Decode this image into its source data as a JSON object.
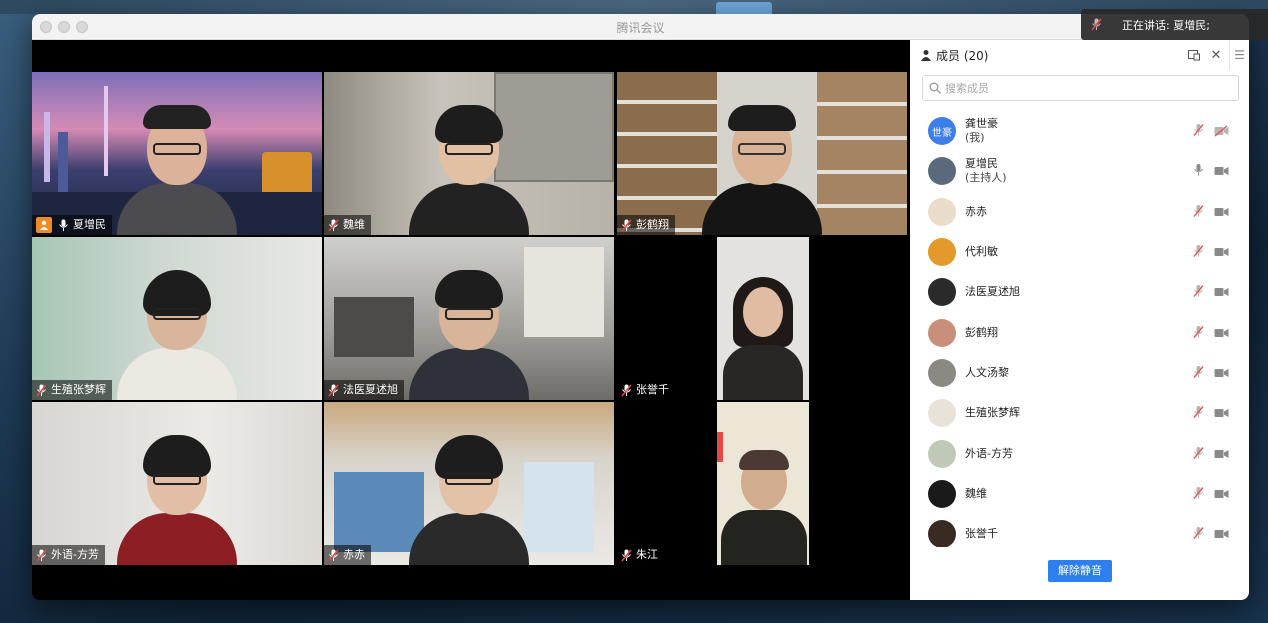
{
  "window": {
    "title": "腾讯会议"
  },
  "toast": {
    "speaking_label": "正在讲话: 夏增民;"
  },
  "tiles": [
    {
      "name": "夏增民",
      "host": true,
      "muted": false,
      "active": true
    },
    {
      "name": "魏维",
      "host": false,
      "muted": true,
      "active": false
    },
    {
      "name": "彭鹤翔",
      "host": false,
      "muted": true,
      "active": false
    },
    {
      "name": "生殖张梦辉",
      "host": false,
      "muted": true,
      "active": false
    },
    {
      "name": "法医夏述旭",
      "host": false,
      "muted": true,
      "active": false
    },
    {
      "name": "张誉千",
      "host": false,
      "muted": true,
      "active": false
    },
    {
      "name": "外语-方芳",
      "host": false,
      "muted": true,
      "active": false
    },
    {
      "name": "赤赤",
      "host": false,
      "muted": true,
      "active": false
    },
    {
      "name": "朱江",
      "host": false,
      "muted": true,
      "active": false
    }
  ],
  "panel": {
    "title": "成员 (20)",
    "search_placeholder": "搜索成员",
    "unmute_all_label": "解除静音",
    "members": [
      {
        "name": "龚世豪",
        "sub": "(我)",
        "avatar_text": "世豪",
        "avatar_color": "#3d7ee8",
        "mic_muted": true,
        "cam_off": true
      },
      {
        "name": "夏增民",
        "sub": "(主持人)",
        "avatar_text": "",
        "avatar_color": "#5a6a7c",
        "mic_muted": false,
        "cam_off": false
      },
      {
        "name": "赤赤",
        "sub": "",
        "avatar_text": "",
        "avatar_color": "#e9dcc8",
        "mic_muted": true,
        "cam_off": false
      },
      {
        "name": "代利敏",
        "sub": "",
        "avatar_text": "",
        "avatar_color": "#e39a2a",
        "mic_muted": true,
        "cam_off": false
      },
      {
        "name": "法医夏述旭",
        "sub": "",
        "avatar_text": "",
        "avatar_color": "#2a2a2a",
        "mic_muted": true,
        "cam_off": false
      },
      {
        "name": "彭鹤翔",
        "sub": "",
        "avatar_text": "",
        "avatar_color": "#c98f7a",
        "mic_muted": true,
        "cam_off": false
      },
      {
        "name": "人文汤黎",
        "sub": "",
        "avatar_text": "",
        "avatar_color": "#8a8a82",
        "mic_muted": true,
        "cam_off": false
      },
      {
        "name": "生殖张梦辉",
        "sub": "",
        "avatar_text": "",
        "avatar_color": "#e8e2d8",
        "mic_muted": true,
        "cam_off": false
      },
      {
        "name": "外语-方芳",
        "sub": "",
        "avatar_text": "",
        "avatar_color": "#bfc9b5",
        "mic_muted": true,
        "cam_off": false
      },
      {
        "name": "魏维",
        "sub": "",
        "avatar_text": "",
        "avatar_color": "#1a1a1a",
        "mic_muted": true,
        "cam_off": false
      },
      {
        "name": "张誉千",
        "sub": "",
        "avatar_text": "",
        "avatar_color": "#3a2b22",
        "mic_muted": true,
        "cam_off": false
      }
    ]
  }
}
